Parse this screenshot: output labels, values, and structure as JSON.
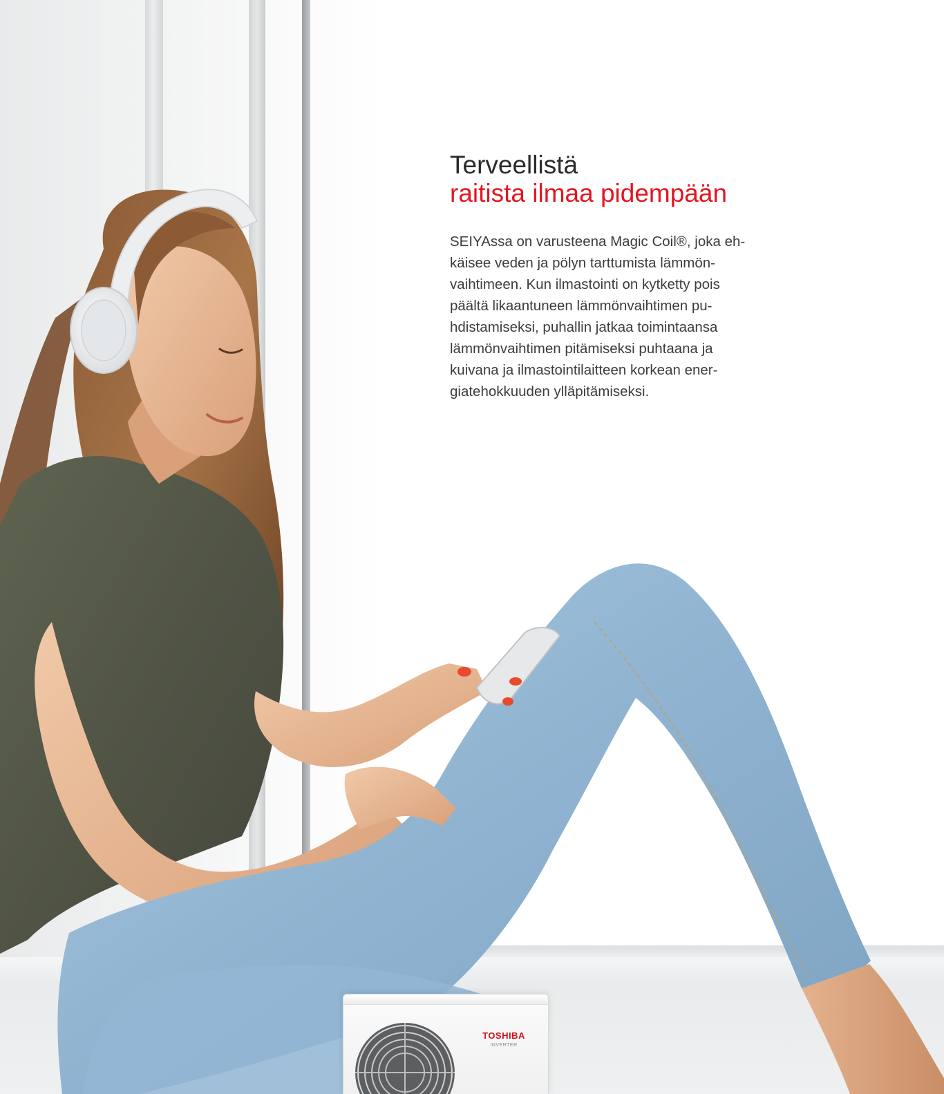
{
  "headline": {
    "line1": "Terveellistä",
    "line2": "raitista ilmaa pidempään"
  },
  "body": {
    "lines": [
      "SEIYAssa on varusteena Magic Coil®, joka eh-",
      "käisee veden ja pölyn tarttumista lämmön-",
      "vaihtimeen. Kun ilmastointi on kytketty pois",
      "päältä likaantuneen lämmönvaihtimen pu-",
      "hdistamiseksi, puhallin jatkaa toimintaansa",
      "lämmönvaihtimen pitämiseksi puhtaana ja",
      "kuivana ja ilmastointilaitteen korkean ener-",
      "giatehokkuuden ylläpitämiseksi."
    ]
  },
  "outdoor_unit": {
    "brand": "TOSHIBA",
    "label": "INVERTER"
  },
  "colors": {
    "accent": "#e5151f",
    "text": "#3c3c3c",
    "heading": "#2b2b2b"
  }
}
